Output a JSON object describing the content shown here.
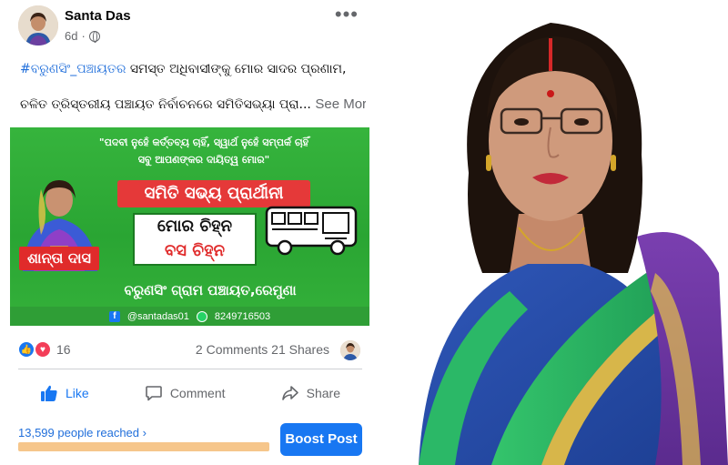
{
  "post": {
    "author": "Santa Das",
    "time": "6d",
    "more_icon": "more-horizontal-icon",
    "hashtag": "#ବରୁଣସିଂ_ପଞ୍ଚାୟତର",
    "line1_rest": " ସମସ୍ତ ଅଧିବାସୀଙ୍କୁ ମୋର ସାଦର ପ୍ରଣାମ,",
    "line2": "ଚଳିତ ତ୍ରିସ୍ତରୀୟ ପଞ୍ଚାୟତ ନିର୍ବାଚନରେ ସମିତିସଭ୍ୟା ପ୍ରା...",
    "see_more": "See More"
  },
  "banner": {
    "quote_line1": "\"ପଦବୀ ନୁହେଁ କର୍ତ୍ତବ୍ୟ ଚାହିଁ, ସ୍ୱାର୍ଥ ନୁହେଁ ସମ୍ପର୍କ ଚାହିଁ",
    "quote_line2": "ସବୁ ଆପଣଙ୍କର ଦାୟିତ୍ୱ ମୋର\"",
    "title": "ସମିତି ସଭ୍ୟ ପ୍ରାର୍ଥୀନୀ",
    "symbol_line1": "ମୋର ଚିହ୍ନ",
    "symbol_line2": "ବସ ଚିହ୍ନ",
    "candidate_name": "ଶାନ୍ତା ଦାସ",
    "place": "ବରୁଣସିଂ ଗ୍ରାମ ପଞ୍ଚାୟତ,ରେମୁଣା",
    "facebook_handle": "@santadas01",
    "phone": "8249716503"
  },
  "engagement": {
    "reaction_count": "16",
    "comments": "2 Comments",
    "shares": "21 Shares"
  },
  "actions": {
    "like": "Like",
    "comment": "Comment",
    "share": "Share"
  },
  "reach": {
    "label": "13,599 people reached",
    "chevron": "›",
    "progress_fraction": 1.0
  },
  "boost": {
    "label": "Boost Post"
  },
  "colors": {
    "facebook_blue": "#1877f2",
    "banner_green": "#2aa533",
    "banner_red": "#e02b2b"
  }
}
